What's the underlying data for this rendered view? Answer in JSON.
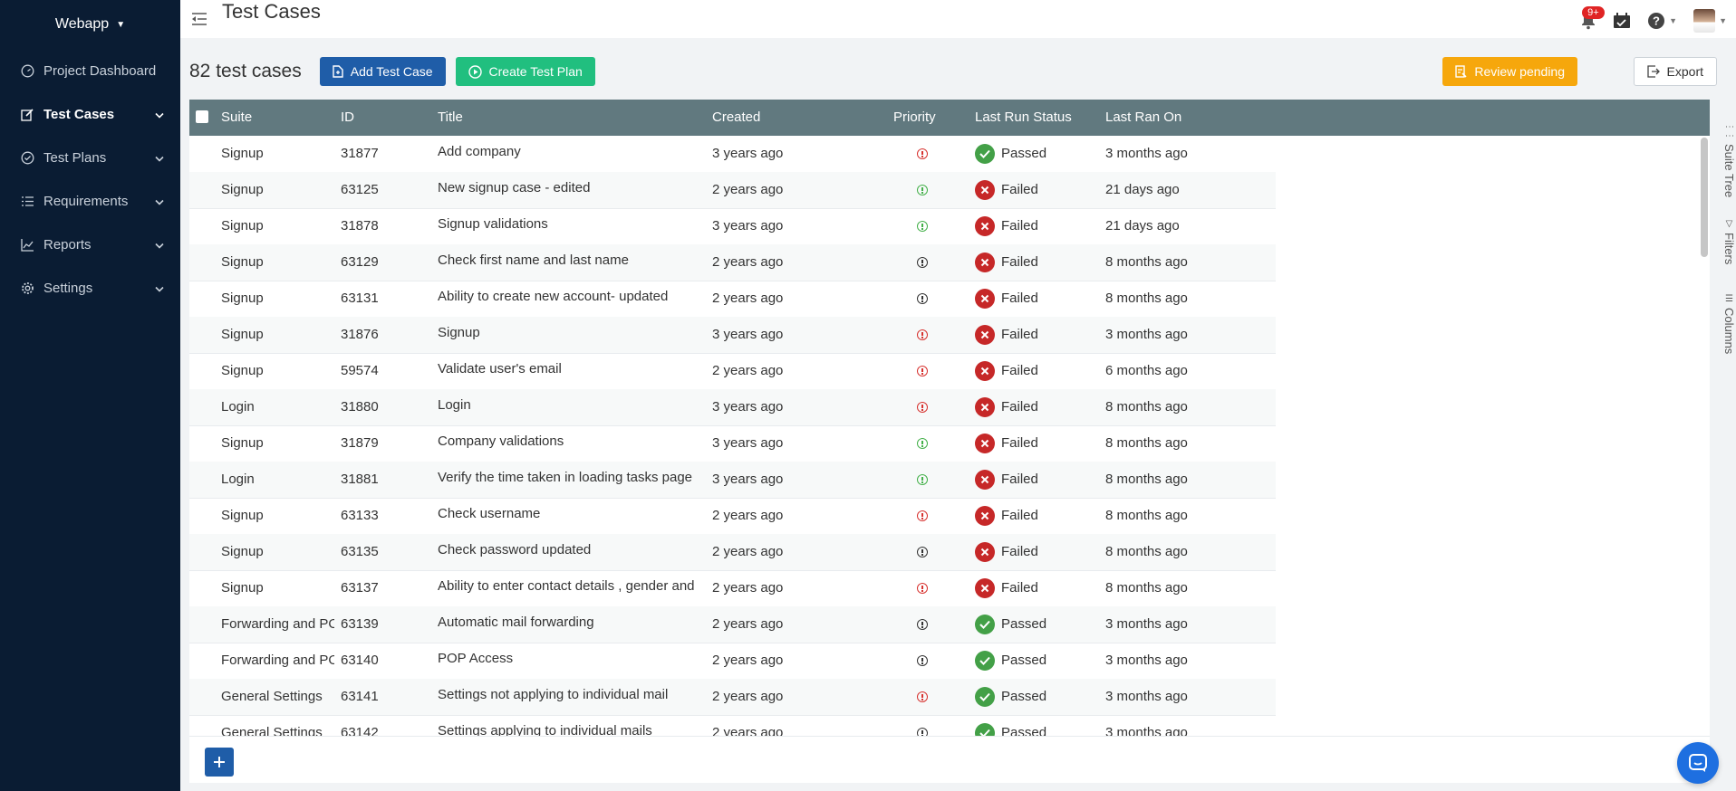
{
  "sidebar": {
    "project": "Webapp",
    "items": [
      {
        "label": "Project Dashboard",
        "icon": "dashboard-icon",
        "expandable": false,
        "active": false
      },
      {
        "label": "Test Cases",
        "icon": "edit-icon",
        "expandable": true,
        "active": true
      },
      {
        "label": "Test Plans",
        "icon": "check-circle-icon",
        "expandable": true,
        "active": false
      },
      {
        "label": "Requirements",
        "icon": "list-icon",
        "expandable": true,
        "active": false
      },
      {
        "label": "Reports",
        "icon": "chart-line-icon",
        "expandable": true,
        "active": false
      },
      {
        "label": "Settings",
        "icon": "gear-icon",
        "expandable": true,
        "active": false
      }
    ]
  },
  "header": {
    "title": "Test Cases",
    "notification_badge": "9+"
  },
  "toolbar": {
    "count_label": "82 test cases",
    "add_test_case": "Add Test Case",
    "create_test_plan": "Create Test Plan",
    "review_pending": "Review pending",
    "export": "Export"
  },
  "table": {
    "columns": [
      "Suite",
      "ID",
      "Title",
      "Created",
      "Priority",
      "Last Run Status",
      "Last Ran On"
    ],
    "rows": [
      {
        "suite": "Signup",
        "id": "31877",
        "title": "Add company",
        "created": "3 years ago",
        "priority": "red",
        "status": "Passed",
        "last_ran": "3 months ago"
      },
      {
        "suite": "Signup",
        "id": "63125",
        "title": "New signup case - edited",
        "created": "2 years ago",
        "priority": "green",
        "status": "Failed",
        "last_ran": "21 days ago"
      },
      {
        "suite": "Signup",
        "id": "31878",
        "title": "Signup validations",
        "created": "3 years ago",
        "priority": "green",
        "status": "Failed",
        "last_ran": "21 days ago"
      },
      {
        "suite": "Signup",
        "id": "63129",
        "title": "Check first name and last name",
        "created": "2 years ago",
        "priority": "dark",
        "status": "Failed",
        "last_ran": "8 months ago"
      },
      {
        "suite": "Signup",
        "id": "63131",
        "title": "Ability to create new account- updated",
        "created": "2 years ago",
        "priority": "dark",
        "status": "Failed",
        "last_ran": "8 months ago"
      },
      {
        "suite": "Signup",
        "id": "31876",
        "title": "Signup",
        "created": "3 years ago",
        "priority": "red",
        "status": "Failed",
        "last_ran": "3 months ago"
      },
      {
        "suite": "Signup",
        "id": "59574",
        "title": "Validate user's email",
        "created": "2 years ago",
        "priority": "red",
        "status": "Failed",
        "last_ran": "6 months ago"
      },
      {
        "suite": "Login",
        "id": "31880",
        "title": "Login",
        "created": "3 years ago",
        "priority": "red",
        "status": "Failed",
        "last_ran": "8 months ago"
      },
      {
        "suite": "Signup",
        "id": "31879",
        "title": "Company validations",
        "created": "3 years ago",
        "priority": "green",
        "status": "Failed",
        "last_ran": "8 months ago"
      },
      {
        "suite": "Login",
        "id": "31881",
        "title": "Verify the time taken in loading tasks page",
        "created": "3 years ago",
        "priority": "green",
        "status": "Failed",
        "last_ran": "8 months ago"
      },
      {
        "suite": "Signup",
        "id": "63133",
        "title": "Check username",
        "created": "2 years ago",
        "priority": "red",
        "status": "Failed",
        "last_ran": "8 months ago"
      },
      {
        "suite": "Signup",
        "id": "63135",
        "title": "Check password updated",
        "created": "2 years ago",
        "priority": "dark",
        "status": "Failed",
        "last_ran": "8 months ago"
      },
      {
        "suite": "Signup",
        "id": "63137",
        "title": "Ability to enter contact details , gender and",
        "created": "2 years ago",
        "priority": "red",
        "status": "Failed",
        "last_ran": "8 months ago"
      },
      {
        "suite": "Forwarding and PO",
        "id": "63139",
        "title": "Automatic mail forwarding",
        "created": "2 years ago",
        "priority": "dark",
        "status": "Passed",
        "last_ran": "3 months ago"
      },
      {
        "suite": "Forwarding and PO",
        "id": "63140",
        "title": "POP Access",
        "created": "2 years ago",
        "priority": "dark",
        "status": "Passed",
        "last_ran": "3 months ago"
      },
      {
        "suite": "General Settings",
        "id": "63141",
        "title": "Settings not applying to individual mail",
        "created": "2 years ago",
        "priority": "red",
        "status": "Passed",
        "last_ran": "3 months ago"
      },
      {
        "suite": "General Settings",
        "id": "63142",
        "title": "Settings applying to individual mails",
        "created": "2 years ago",
        "priority": "dark",
        "status": "Passed",
        "last_ran": "3 months ago"
      }
    ]
  },
  "side_tabs": [
    {
      "label": "Suite Tree",
      "icon": "tree-icon"
    },
    {
      "label": "Filters",
      "icon": "filter-icon"
    },
    {
      "label": "Columns",
      "icon": "columns-icon"
    }
  ],
  "colors": {
    "sidebar_bg": "#0a1c33",
    "primary_blue": "#1f5da8",
    "green": "#21bf7f",
    "orange": "#f6a70c",
    "table_header": "#61797f",
    "passed": "#43a047",
    "failed": "#c62828"
  }
}
